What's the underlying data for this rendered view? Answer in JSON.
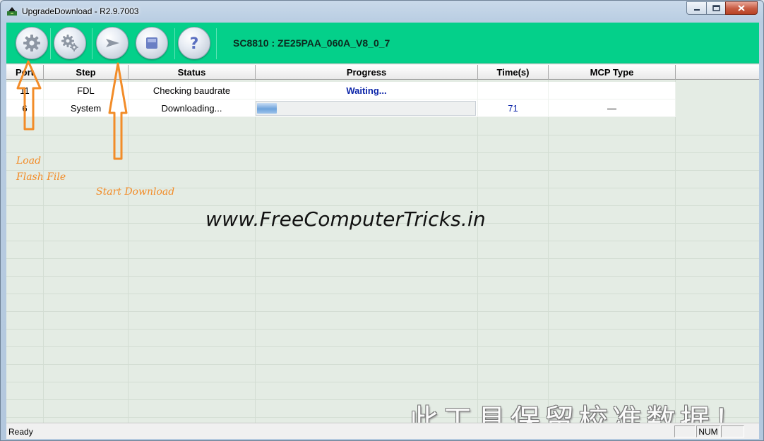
{
  "window": {
    "title": "UpgradeDownload  -  R2.9.7003"
  },
  "toolbar": {
    "buttons": [
      {
        "id": "load",
        "icon": "gear-icon"
      },
      {
        "id": "settings",
        "icon": "gears-icon"
      },
      {
        "id": "start",
        "icon": "play-arrow-icon"
      },
      {
        "id": "stop",
        "icon": "stop-icon"
      },
      {
        "id": "help",
        "icon": "question-icon"
      }
    ],
    "title": "SC8810 :  ZE25PAA_060A_V8_0_7",
    "background": "#04d08a"
  },
  "grid": {
    "columns": [
      "Port",
      "Step",
      "Status",
      "Progress",
      "Time(s)",
      "MCP Type"
    ],
    "rows": [
      {
        "port": "11",
        "step": "FDL",
        "status": "Checking baudrate",
        "progress_text": "Waiting...",
        "time": "",
        "mcp_type": ""
      },
      {
        "port": "6",
        "step": "System",
        "status": "Downloading...",
        "progress_fraction": 0.09,
        "time": "71",
        "mcp_type": "—"
      }
    ]
  },
  "overlay": {
    "load_label_1": "Load",
    "load_label_2": "Flash File",
    "start_label": "Start Download",
    "watermark": "www.FreeComputerTricks.in",
    "chinese_text": "此工具保留校准数据！",
    "arrow_color": "#f28c28"
  },
  "statusbar": {
    "status": "Ready",
    "num": "NUM"
  }
}
